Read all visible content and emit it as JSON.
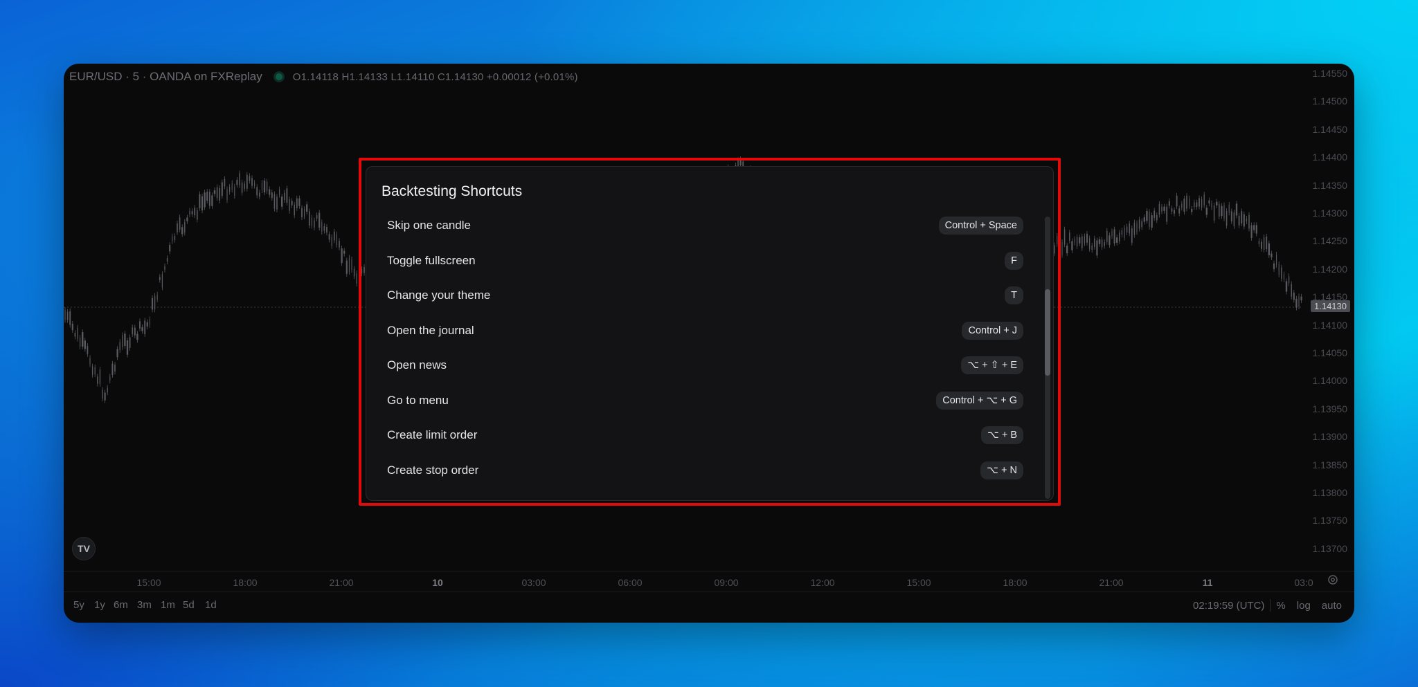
{
  "chart": {
    "symbol_title": "EUR/USD · 5 · OANDA on FXReplay",
    "ohlc": "O1.14118 H1.14133 L1.14110 C1.14130 +0.00012 (+0.01%)",
    "current_price": "1.14130",
    "price_labels": [
      "1.14550",
      "1.14500",
      "1.14450",
      "1.14400",
      "1.14350",
      "1.14300",
      "1.14250",
      "1.14200",
      "1.14150",
      "1.14100",
      "1.14050",
      "1.14000",
      "1.13950",
      "1.13900",
      "1.13850",
      "1.13800",
      "1.13750",
      "1.13700"
    ],
    "time_labels": [
      "15:00",
      "18:00",
      "21:00",
      "10",
      "03:00",
      "06:00",
      "09:00",
      "12:00",
      "15:00",
      "18:00",
      "21:00",
      "11",
      "03:0"
    ],
    "range_buttons": [
      "5y",
      "1y",
      "6m",
      "3m",
      "1m",
      "5d",
      "1d"
    ],
    "clock": "02:19:59 (UTC)",
    "percent_label": "%",
    "log_label": "log",
    "auto_label": "auto",
    "logo_text": "TV"
  },
  "modal": {
    "title": "Backtesting Shortcuts",
    "shortcuts": [
      {
        "label": "Skip one candle",
        "keys": "Control + Space"
      },
      {
        "label": "Toggle fullscreen",
        "keys": "F"
      },
      {
        "label": "Change your theme",
        "keys": "T"
      },
      {
        "label": "Open the journal",
        "keys": "Control + J"
      },
      {
        "label": "Open news",
        "keys": "⌥ + ⇧ + E"
      },
      {
        "label": "Go to menu",
        "keys": "Control + ⌥ + G"
      },
      {
        "label": "Create limit order",
        "keys": "⌥ + B"
      },
      {
        "label": "Create stop order",
        "keys": "⌥ + N"
      }
    ]
  },
  "colors": {
    "highlight": "#e10b0b",
    "candle": "#5a5b60"
  }
}
